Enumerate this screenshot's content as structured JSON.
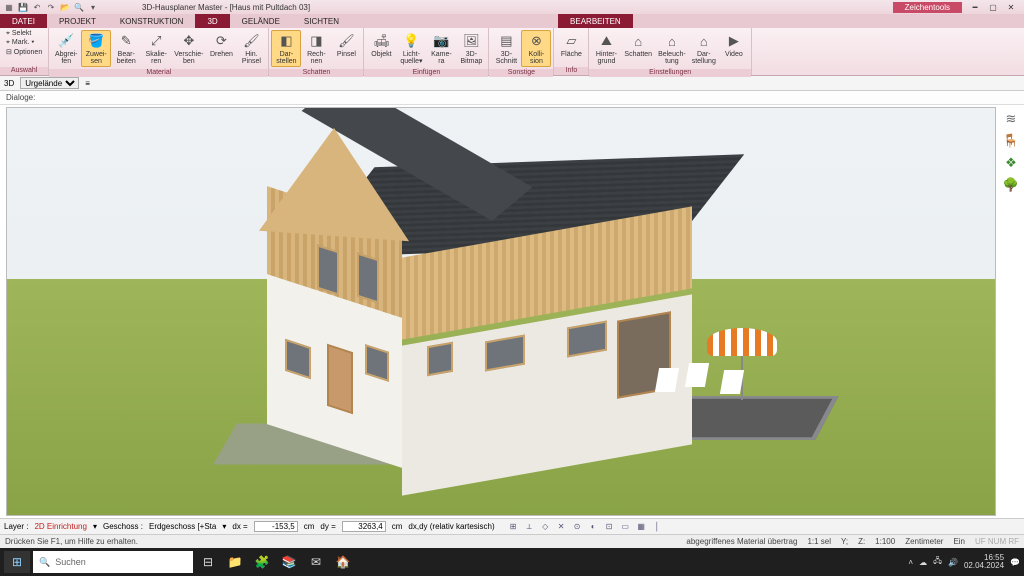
{
  "title": "3D-Hausplaner Master - [Haus mit Pultdach 03]",
  "zeichentools": "Zeichentools",
  "tabs": {
    "datei": "DATEI",
    "projekt": "PROJEKT",
    "konstruktion": "KONSTRUKTION",
    "d3": "3D",
    "gelaende": "GELÄNDE",
    "sichten": "SICHTEN",
    "bearbeiten": "BEARBEITEN"
  },
  "auswahl": {
    "selekt": "⌖ Selekt",
    "mark": "⌖ Mark. ▾",
    "optionen": "⊟ Optionen",
    "group": "Auswahl"
  },
  "ribbon": {
    "material": {
      "label": "Material",
      "abgreifen": "Abgrei-\nfen",
      "zuweisen": "Zuwei-\nsen",
      "bearbeiten": "Bear-\nbeiten",
      "skalieren": "Skalie-\nren",
      "verschieben": "Verschie-\nben",
      "drehen": "Drehen",
      "hinpinsel": "Hin.\nPinsel"
    },
    "schatten": {
      "label": "Schatten",
      "darstellen": "Dar-\nstellen",
      "rechnen": "Rech-\nnen",
      "pinsel": "Pinsel"
    },
    "einfuegen": {
      "label": "Einfügen",
      "objekt": "Objekt",
      "licht": "Licht-\nquelle▾",
      "kamera": "Kame-\nra",
      "bitmap": "3D-\nBitmap"
    },
    "sonstige": {
      "label": "Sonstige",
      "schnitt": "3D-\nSchnitt",
      "kollision": "Kolli-\nsion"
    },
    "info": {
      "label": "Info",
      "flaeche": "Fläche"
    },
    "einstellungen": {
      "label": "Einstellungen",
      "hintergrund": "Hinter-\ngrund",
      "schatten": "Schatten",
      "beleuchtung": "Beleuch-\ntung",
      "darstellung": "Dar-\nstellung",
      "video": "Video"
    }
  },
  "viewbar": {
    "mode": "3D",
    "layer": "Urgelände"
  },
  "dialoge": "Dialoge:",
  "layerbar": {
    "layer_lbl": "Layer :",
    "layer_val": "2D Einrichtung",
    "geschoss_lbl": "Geschoss :",
    "geschoss_val": "Erdgeschoss [+Sta",
    "dx_lbl": "dx =",
    "dx_val": "-153,5",
    "cm1": "cm",
    "dy_lbl": "dy =",
    "dy_val": "3263,4",
    "cm2": "cm",
    "coords": "dx,dy (relativ kartesisch)"
  },
  "status": {
    "help": "Drücken Sie F1, um Hilfe zu erhalten.",
    "material": "abgegriffenes Material übertrag",
    "sel": "1:1 sel",
    "y": "Y;",
    "z": "Z:",
    "scale": "1:100",
    "unit": "Zentimeter",
    "ein": "Ein",
    "uf": "UF NUM RF"
  },
  "taskbar": {
    "search_placeholder": "Suchen",
    "time": "16:55",
    "date": "02.04.2024"
  }
}
